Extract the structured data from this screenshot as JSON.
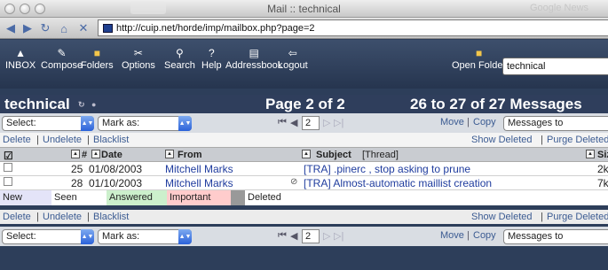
{
  "window": {
    "title": "Mail :: technical",
    "ghost_tab": "Google News"
  },
  "browser": {
    "url": "http://cuip.net/horde/imp/mailbox.php?page=2"
  },
  "nav": {
    "items": [
      {
        "label": "INBOX",
        "icon": "inbox-icon"
      },
      {
        "label": "Compose",
        "icon": "compose-icon"
      },
      {
        "label": "Folders",
        "icon": "folders-icon"
      },
      {
        "label": "Options",
        "icon": "options-icon"
      },
      {
        "label": "Search",
        "icon": "search-icon"
      },
      {
        "label": "Help",
        "icon": "help-icon"
      },
      {
        "label": "Addressbook",
        "icon": "addressbook-icon"
      },
      {
        "label": "Logout",
        "icon": "logout-icon"
      }
    ],
    "open_folder_label": "Open Folder",
    "folder_value": "technical"
  },
  "mailbox": {
    "name": "technical",
    "page_text": "Page 2 of 2",
    "count_text": "26 to 27 of 27 Messages"
  },
  "controls": {
    "select_label": "Select:",
    "markas_label": "Mark as:",
    "page_value": "2",
    "move": "Move",
    "copy": "Copy",
    "messages_to": "Messages to",
    "sep": "|"
  },
  "links": {
    "delete": "Delete",
    "undelete": "Undelete",
    "blacklist": "Blacklist",
    "show_deleted": "Show Deleted",
    "purge_deleted": "Purge Deleted"
  },
  "columns": {
    "num": "#",
    "date": "Date",
    "from": "From",
    "subject": "Subject",
    "thread": "[Thread]",
    "size": "Size"
  },
  "messages": [
    {
      "num": "25",
      "date": "01/08/2003",
      "from": "Mitchell Marks",
      "subject": "[TRA] .pinerc , stop asking to prune",
      "size": "2k",
      "attachment": false
    },
    {
      "num": "28",
      "date": "01/10/2003",
      "from": "Mitchell Marks",
      "subject": "[TRA] Almost-automatic maillist creation",
      "size": "7k",
      "attachment": true
    }
  ],
  "legend": [
    {
      "label": "New",
      "color": "#e4e4f8"
    },
    {
      "label": "Seen",
      "color": "#ffffff"
    },
    {
      "label": "Answered",
      "color": "#ccf0cc"
    },
    {
      "label": "Important",
      "color": "#ffcccc"
    },
    {
      "label": "Deleted",
      "color": "#999999"
    }
  ]
}
